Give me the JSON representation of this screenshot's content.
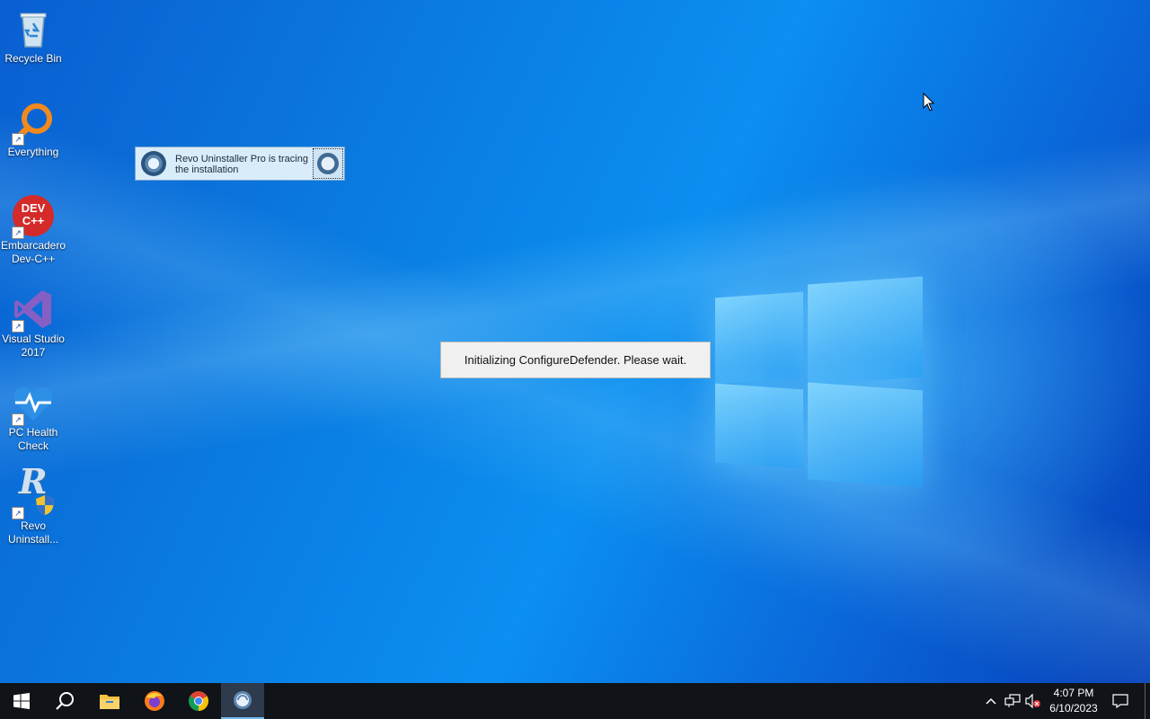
{
  "desktop": {
    "icons": [
      {
        "label": "Recycle Bin",
        "icon": "recycle-bin-icon"
      },
      {
        "label": "Everything",
        "icon": "everything-search-icon"
      },
      {
        "label": "Embarcadero Dev-C++",
        "icon": "devcpp-icon",
        "icon_text": "DEV C++"
      },
      {
        "label": "Visual Studio 2017",
        "icon": "visual-studio-icon"
      },
      {
        "label": "PC Health Check",
        "icon": "pc-health-check-icon"
      },
      {
        "label": "Revo Uninstall...",
        "icon": "revo-uninstaller-icon",
        "icon_text": "R"
      }
    ]
  },
  "revo_tracing": {
    "text": "Revo Uninstaller Pro is tracing the installation"
  },
  "dialog": {
    "message": "Initializing ConfigureDefender. Please wait."
  },
  "taskbar": {
    "buttons": [
      {
        "name": "start",
        "icon": "windows-start-icon"
      },
      {
        "name": "search",
        "icon": "search-icon"
      },
      {
        "name": "file-explorer",
        "icon": "folder-icon"
      },
      {
        "name": "firefox",
        "icon": "firefox-icon"
      },
      {
        "name": "chrome",
        "icon": "chrome-icon"
      },
      {
        "name": "revo-uninstaller",
        "icon": "revo-uninstaller-icon",
        "active": true
      }
    ],
    "tray": {
      "time": "4:07 PM",
      "date": "6/10/2023",
      "icons": [
        "chevron-up-icon",
        "network-icon",
        "volume-muted-icon",
        "notification-icon"
      ]
    }
  },
  "colors": {
    "desktop_blue": "#0a7ae0",
    "taskbar": "#101318",
    "active_underline": "#76b9ed"
  }
}
